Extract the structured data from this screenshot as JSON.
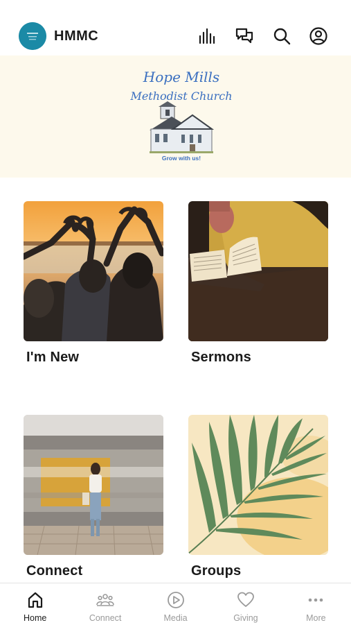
{
  "header": {
    "app_name": "HMMC",
    "icons": [
      "bars-icon",
      "chat-icon",
      "search-icon",
      "profile-icon"
    ]
  },
  "banner": {
    "line1": "Hope Mills",
    "line2": "Methodist Church",
    "tagline": "Grow with us!"
  },
  "tiles": [
    {
      "label": "I'm New"
    },
    {
      "label": "Sermons"
    },
    {
      "label": "Connect"
    },
    {
      "label": "Groups"
    }
  ],
  "tabbar": {
    "items": [
      {
        "label": "Home",
        "icon": "home-icon",
        "active": true
      },
      {
        "label": "Connect",
        "icon": "people-icon",
        "active": false
      },
      {
        "label": "Media",
        "icon": "play-icon",
        "active": false
      },
      {
        "label": "Giving",
        "icon": "heart-icon",
        "active": false
      },
      {
        "label": "More",
        "icon": "more-icon",
        "active": false
      }
    ]
  },
  "colors": {
    "accent": "#1b8aa6",
    "banner_bg": "#fdf9ec",
    "banner_script": "#3a6fc0",
    "inactive_tab": "#9a9a9a"
  }
}
